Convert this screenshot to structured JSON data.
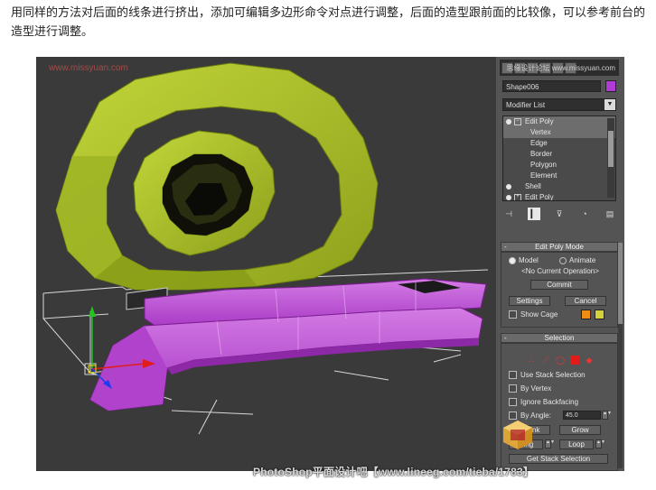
{
  "caption": "用同样的方法对后面的线条进行挤出，添加可编辑多边形命令对点进行调整，后面的造型跟前面的比较像，可以参考前台的造型进行调整。",
  "viewport": {
    "label": "www.missyuan.com"
  },
  "panel": {
    "watermark": "思缘设计论坛 www.missyuan.com",
    "object_name": "Shape006",
    "object_color": "#b13bd6",
    "modifier_list": "Modifier List",
    "stack": [
      {
        "label": "Edit Poly",
        "level": 0,
        "selected": true
      },
      {
        "label": "Vertex",
        "level": 1,
        "selected": true
      },
      {
        "label": "Edge",
        "level": 1,
        "selected": false
      },
      {
        "label": "Border",
        "level": 1,
        "selected": false
      },
      {
        "label": "Polygon",
        "level": 1,
        "selected": false
      },
      {
        "label": "Element",
        "level": 1,
        "selected": false
      },
      {
        "label": "Shell",
        "level": 0,
        "selected": false
      },
      {
        "label": "Edit Poly",
        "level": 0,
        "selected": false
      }
    ],
    "edit_poly_mode": {
      "title": "Edit Poly Mode",
      "model": "Model",
      "animate": "Animate",
      "current_op": "<No Current Operation>",
      "commit": "Commit",
      "settings": "Settings",
      "cancel": "Cancel",
      "show_cage": "Show Cage"
    },
    "selection": {
      "title": "Selection",
      "use_stack": "Use Stack Selection",
      "by_vertex": "By Vertex",
      "ignore_backfacing": "Ignore Backfacing",
      "by_angle": "By Angle:",
      "angle_value": "45.0",
      "shrink": "Shrink",
      "grow": "Grow",
      "ring": "Ring",
      "loop": "Loop",
      "get_stack": "Get Stack Selection"
    }
  },
  "footer_watermark": "PhotoShop平面设计吧【www.lineeg.com/tieba/1783】",
  "colors": {
    "accent_yellow": "#b6cc2a",
    "accent_purple": "#c04fd6",
    "cage_orange": "#ef8d14",
    "cage_yellow": "#d4d23a"
  }
}
